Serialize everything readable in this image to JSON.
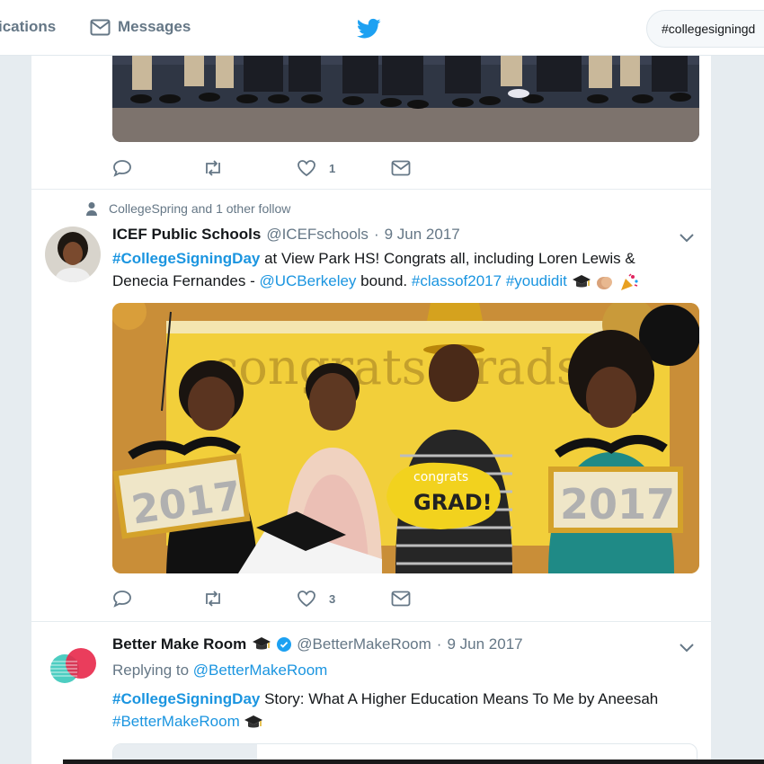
{
  "topbar": {
    "notifications_label": "ications",
    "messages_label": "Messages",
    "search_value": "#collegesigningd"
  },
  "tweet1": {
    "like_count": "1"
  },
  "tweet2": {
    "context": "CollegeSpring and 1 other follow",
    "name": "ICEF Public Schools",
    "handle": "@ICEFschools",
    "sep": "·",
    "date": "9 Jun 2017",
    "text": {
      "hashtag_signing": "#CollegeSigningDay",
      "part1": " at View Park HS! Congrats all, including Loren Lewis &",
      "part2": "Denecia Fernandes - ",
      "mention": "@UCBerkeley",
      "part3": " bound. ",
      "hashtag_class": "#classof2017",
      "space": " ",
      "hashtag_youdidit": "#youdidit"
    },
    "photo_banner": "congrats grads",
    "sign_left": "2017",
    "sign_right": "2017",
    "grad_sign_top": "congrats",
    "grad_sign": "GRAD!",
    "like_count": "3"
  },
  "tweet3": {
    "name": "Better Make Room",
    "handle": "@BetterMakeRoom",
    "sep": "·",
    "date": "9 Jun 2017",
    "replying_prefix": "Replying to ",
    "replying_handle": "@BetterMakeRoom",
    "text": {
      "hashtag_signing": "#CollegeSigningDay",
      "part1": " Story: What A Higher Education Means To Me by Aneesah",
      "hashtag_room": "#BetterMakeRoom"
    }
  },
  "colors": {
    "twitter_blue": "#1da1f2",
    "link_blue": "#1b95e0",
    "secondary_text": "#657786"
  }
}
